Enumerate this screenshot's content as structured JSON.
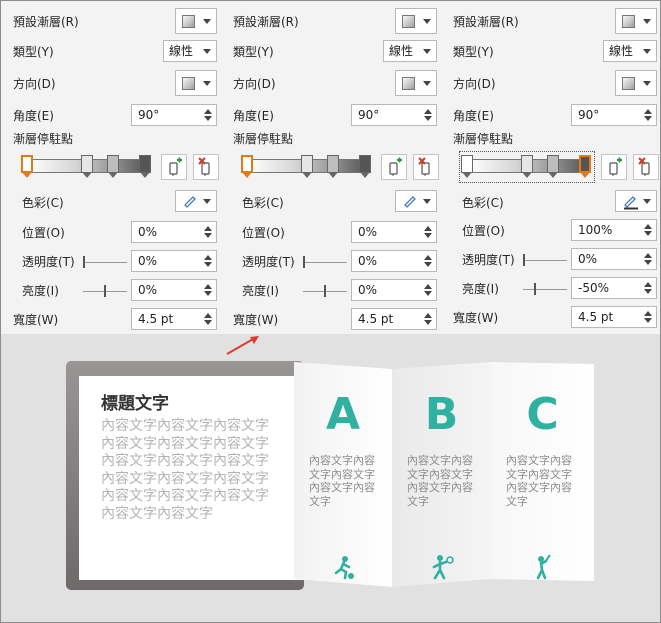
{
  "panels": [
    {
      "preset_label": "預設漸層(R)",
      "type_label": "類型(Y)",
      "type_value": "線性",
      "direction_label": "方向(D)",
      "angle_label": "角度(E)",
      "angle_value": "90°",
      "stops_label": "漸層停駐點",
      "color_label": "色彩(C)",
      "position_label": "位置(O)",
      "position_value": "0%",
      "transparency_label": "透明度(T)",
      "transparency_value": "0%",
      "brightness_label": "亮度(I)",
      "brightness_value": "0%",
      "width_label": "寬度(W)",
      "width_value": "4.5 pt",
      "selected_stop": 0
    },
    {
      "preset_label": "預設漸層(R)",
      "type_label": "類型(Y)",
      "type_value": "線性",
      "direction_label": "方向(D)",
      "angle_label": "角度(E)",
      "angle_value": "90°",
      "stops_label": "漸層停駐點",
      "color_label": "色彩(C)",
      "position_label": "位置(O)",
      "position_value": "0%",
      "transparency_label": "透明度(T)",
      "transparency_value": "0%",
      "brightness_label": "亮度(I)",
      "brightness_value": "0%",
      "width_label": "寬度(W)",
      "width_value": "4.5 pt",
      "selected_stop": 0
    },
    {
      "preset_label": "預設漸層(R)",
      "type_label": "類型(Y)",
      "type_value": "線性",
      "direction_label": "方向(D)",
      "angle_label": "角度(E)",
      "angle_value": "90°",
      "stops_label": "漸層停駐點",
      "color_label": "色彩(C)",
      "position_label": "位置(O)",
      "position_value": "100%",
      "transparency_label": "透明度(T)",
      "transparency_value": "0%",
      "brightness_label": "亮度(I)",
      "brightness_value": "-50%",
      "width_label": "寬度(W)",
      "width_value": "4.5 pt",
      "selected_stop": 3
    }
  ],
  "slide": {
    "title": "標題文字",
    "body": "內容文字內容文字內容文字內容文字內容文字內容文字內容文字內容文字內容文字內容文字內容文字內容文字內容文字內容文字內容文字內容文字內容文字",
    "folds": [
      {
        "letter": "A",
        "text": "內容文字內容文字內容文字內容文字內容文字",
        "icon": "soccer-player-icon"
      },
      {
        "letter": "B",
        "text": "內容文字內容文字內容文字內容文字內容文字",
        "icon": "tennis-player-icon"
      },
      {
        "letter": "C",
        "text": "內容文字內容文字內容文字內容文字內容文字",
        "icon": "baseball-batter-icon"
      }
    ]
  },
  "colors": {
    "accent_teal": "#2fb0a0",
    "selection_orange": "#e07a1a",
    "arrow_red": "#e03a2e"
  }
}
